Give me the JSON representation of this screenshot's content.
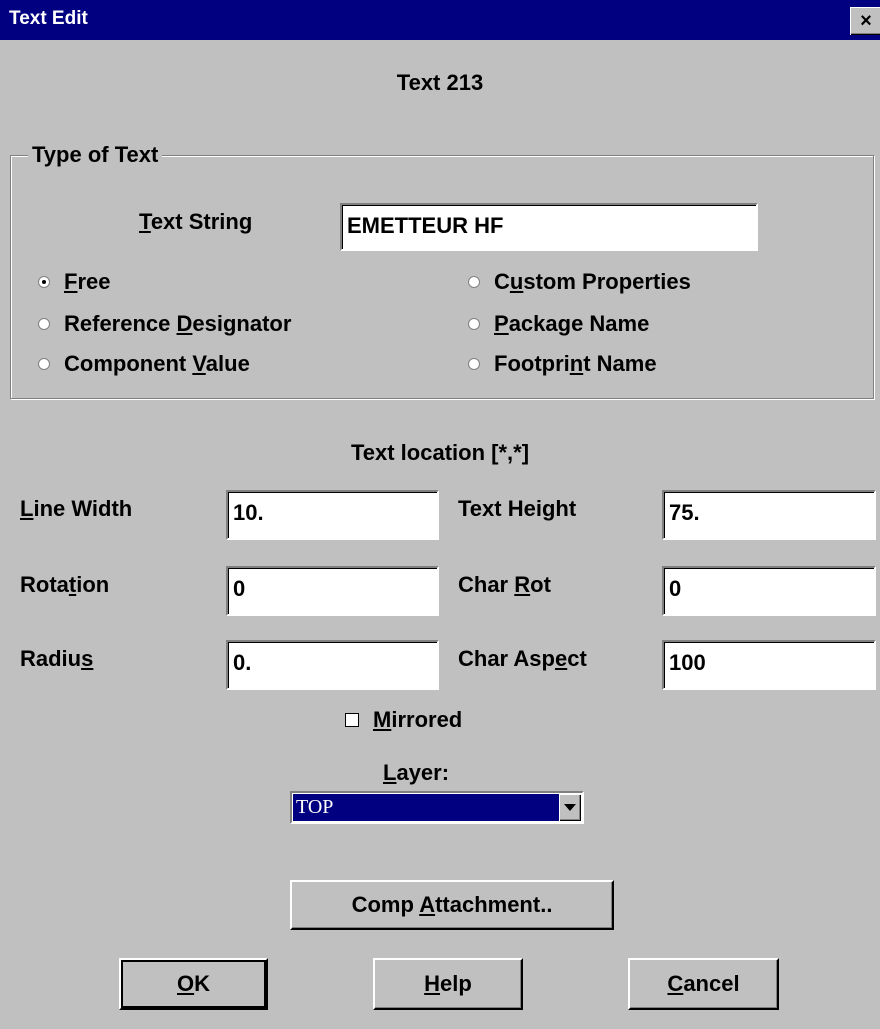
{
  "window": {
    "title": "Text Edit",
    "close_glyph": "×"
  },
  "header": {
    "text_id": "Text 213"
  },
  "type_group": {
    "legend": "Type of Text",
    "text_string_label_u": "T",
    "text_string_label_rest": "ext String",
    "text_string_value": "EMETTEUR HF",
    "radios": {
      "free": {
        "pre": "",
        "u": "F",
        "post": "ree",
        "checked": true
      },
      "ref": {
        "pre": "Reference ",
        "u": "D",
        "post": "esignator",
        "checked": false
      },
      "comp": {
        "pre": "Component ",
        "u": "V",
        "post": "alue",
        "checked": false
      },
      "custom": {
        "pre": "C",
        "u": "u",
        "post": "stom Properties",
        "checked": false
      },
      "package": {
        "pre": "",
        "u": "P",
        "post": "ackage Name",
        "checked": false
      },
      "footprint": {
        "pre": "Footpri",
        "u": "n",
        "post": "t Name",
        "checked": false
      }
    }
  },
  "location": {
    "label": "Text location [*,*]"
  },
  "fields": {
    "line_width": {
      "pre": "",
      "u": "L",
      "post": "ine Width",
      "value": "10."
    },
    "text_height": {
      "pre": "Text Height",
      "u": "",
      "post": "",
      "value": "75."
    },
    "rotation": {
      "pre": "Rota",
      "u": "t",
      "post": "ion",
      "value": "0"
    },
    "char_rot": {
      "pre": "Char ",
      "u": "R",
      "post": "ot",
      "value": "0"
    },
    "radius": {
      "pre": "Radiu",
      "u": "s",
      "post": "",
      "value": "0."
    },
    "char_aspect": {
      "pre": "Char Asp",
      "u": "e",
      "post": "ct",
      "value": "100"
    }
  },
  "mirrored": {
    "u": "M",
    "post": "irrored",
    "checked": false
  },
  "layer": {
    "u": "L",
    "post": "ayer:",
    "value": "TOP"
  },
  "buttons": {
    "comp_attach": {
      "pre": "Comp ",
      "u": "A",
      "post": "ttachment.."
    },
    "ok": {
      "u": "O",
      "post": "K"
    },
    "help": {
      "u": "H",
      "post": "elp"
    },
    "cancel": {
      "u": "C",
      "post": "ancel"
    }
  }
}
